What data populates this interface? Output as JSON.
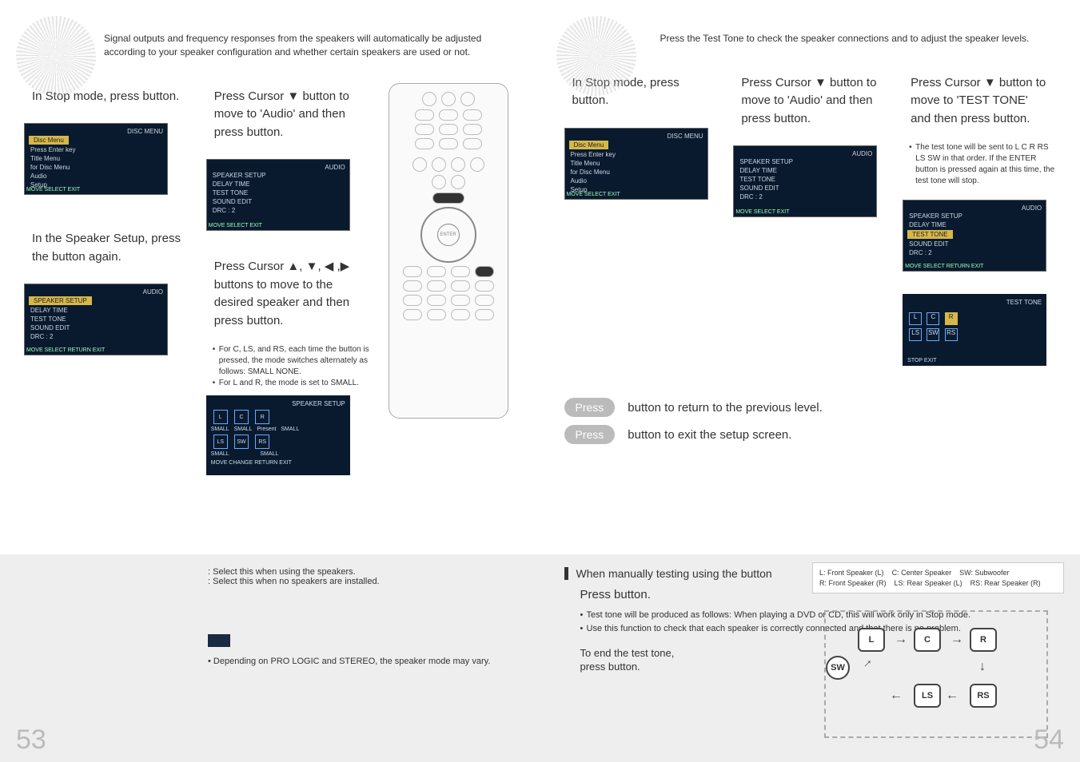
{
  "page_left": {
    "intro": "Signal outputs and frequency responses from the speakers will automatically be adjusted according to your speaker configuration and whether certain speakers are used or not.",
    "step1": "In Stop mode, press button.",
    "step2": "Press Cursor ▼ button to move to 'Audio' and then press button.",
    "step3": "In the Speaker Setup, press the button again.",
    "step4": "Press Cursor ▲, ▼, ◀ ,▶ buttons to move to the desired speaker and then press button.",
    "bullets4": [
      "For C, LS, and RS, each time the button is pressed, the mode switches alternately as follows: SMALL    NONE.",
      "For L and R, the mode is set to SMALL."
    ],
    "osd1": {
      "title": "DISC MENU",
      "rows": [
        "Disc Menu",
        "Press Enter key",
        "Title Menu",
        "for Disc Menu",
        "Audio",
        "Setup"
      ],
      "bar": "MOVE   SELECT                         EXIT"
    },
    "osd2": {
      "title": "AUDIO",
      "rows": [
        "SPEAKER SETUP",
        "DELAY TIME",
        "TEST TONE",
        "SOUND EDIT",
        "DRC        : 2"
      ],
      "bar": "MOVE   SELECT                         EXIT"
    },
    "osd3": {
      "title": "AUDIO",
      "rows_hl": "SPEAKER SETUP",
      "rows": [
        "DELAY TIME",
        "TEST TONE",
        "SOUND EDIT",
        "DRC        : 2"
      ],
      "bar": "MOVE   SELECT   RETURN   EXIT"
    },
    "osd4": {
      "title": "SPEAKER SETUP",
      "labels": [
        "SMALL",
        "SMALL",
        "Present",
        "SMALL",
        "SMALL",
        "SMALL"
      ],
      "bar": "MOVE   CHANGE   RETURN   EXIT"
    },
    "note_select1": ": Select this when using the speakers.",
    "note_select2": ": Select this when no speakers are installed.",
    "note_depend": "Depending on PRO LOGIC and STEREO, the speaker mode may vary.",
    "pagenum": "53"
  },
  "page_right": {
    "intro": "Press the Test Tone to check the speaker connections and to adjust the speaker levels.",
    "step1": "In Stop mode, press button.",
    "step2": "Press Cursor ▼ button to move to 'Audio' and then press button.",
    "step3": "Press Cursor ▼ button to move to 'TEST TONE' and then press button.",
    "bullets3": [
      "The test tone will be sent to L    C    R    RS    LS    SW in that order. If the ENTER button is pressed again at this time, the test tone will stop."
    ],
    "osd1": {
      "title": "DISC MENU",
      "rows": [
        "Disc Menu",
        "Press Enter key",
        "Title Menu",
        "for Disc Menu",
        "Audio",
        "Setup"
      ],
      "bar": "MOVE   SELECT                         EXIT"
    },
    "osd2": {
      "title": "AUDIO",
      "rows": [
        "SPEAKER SETUP",
        "DELAY TIME",
        "TEST TONE",
        "SOUND EDIT",
        "DRC        : 2"
      ],
      "bar": "MOVE   SELECT                         EXIT"
    },
    "osd3": {
      "title": "AUDIO",
      "rows": [
        "SPEAKER SETUP",
        "DELAY TIME"
      ],
      "rows_hl": "TEST TONE",
      "rows2": [
        "SOUND EDIT",
        "DRC        : 2"
      ],
      "bar": "MOVE   SELECT   RETURN   EXIT"
    },
    "osd4": {
      "title": "TEST TONE",
      "bar": "STOP              EXIT"
    },
    "return_line": "button to return to the previous level.",
    "exit_line": "button to exit the setup screen.",
    "press": "Press",
    "note_head": "When manually testing using the                         button",
    "legend": {
      "l": "L: Front Speaker (L)",
      "c": "C: Center Speaker",
      "sw": "SW: Subwoofer",
      "r": "R: Front Speaker (R)",
      "ls": "LS: Rear Speaker (L)",
      "rs": "RS: Rear Speaker (R)"
    },
    "manual_press": "Press                    button.",
    "manual_bullets": [
      "Test tone will be produced as follows: When playing a DVD or CD, this will work only in Stop mode.",
      "Use this function to check that each speaker is correctly connected and that there is no problem."
    ],
    "end1": "To end the test tone,",
    "end2": "press                     button.",
    "flow": {
      "L": "L",
      "C": "C",
      "R": "R",
      "SW": "SW",
      "LS": "LS",
      "RS": "RS"
    },
    "pagenum": "54"
  },
  "remote": {
    "enter": "ENTER"
  }
}
